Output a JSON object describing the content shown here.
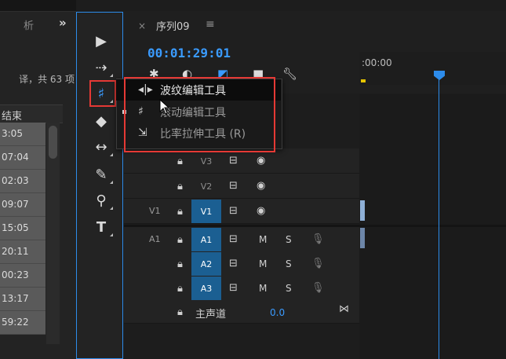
{
  "project_panel": {
    "tab_label": "析",
    "collapse_icon": "double-chevron-right",
    "count_text": "译，共 63 项",
    "column_header": "结束",
    "rows": [
      "3:05",
      "07:04",
      "02:03",
      "09:07",
      "15:05",
      "20:11",
      "00:23",
      "13:17",
      "59:22"
    ]
  },
  "tools": [
    {
      "name": "selection-tool-icon",
      "glyph": "▶"
    },
    {
      "name": "track-select-tool-icon",
      "glyph": "⇢"
    },
    {
      "name": "ripple-edit-tool-icon",
      "glyph": "♯"
    },
    {
      "name": "razor-tool-icon",
      "glyph": "◆"
    },
    {
      "name": "slip-tool-icon",
      "glyph": "↔"
    },
    {
      "name": "pen-tool-icon",
      "glyph": "✎"
    },
    {
      "name": "zoom-tool-icon",
      "glyph": "⚲"
    },
    {
      "name": "type-tool-icon",
      "glyph": "T"
    }
  ],
  "sequence": {
    "close": "×",
    "title": "序列09",
    "menu": "≡",
    "timecode": "00:01:29:01",
    "ruler_label": ":00:00"
  },
  "tracks": [
    {
      "id": "V3",
      "source": "",
      "kind": "video",
      "selected": false
    },
    {
      "id": "V2",
      "source": "",
      "kind": "video",
      "selected": false
    },
    {
      "id": "V1",
      "source": "V1",
      "kind": "video",
      "selected": true
    },
    {
      "id": "A1",
      "source": "A1",
      "kind": "audio",
      "selected": true
    },
    {
      "id": "A2",
      "source": "",
      "kind": "audio",
      "selected": true
    },
    {
      "id": "A3",
      "source": "",
      "kind": "audio",
      "selected": true
    }
  ],
  "master": {
    "label": "主声道",
    "value": "0.0"
  },
  "audio_buttons": {
    "mute": "M",
    "solo": "S"
  },
  "dropdown": {
    "items": [
      {
        "label": "波纹编辑工具",
        "icon": "ripple-edit-icon",
        "glyph": "◂|▸",
        "dim": false,
        "highlight": true
      },
      {
        "label": "滚动编辑工具",
        "icon": "rolling-edit-icon",
        "glyph": "♯",
        "dim": true,
        "highlight": false
      },
      {
        "label": "比率拉伸工具 (R)",
        "icon": "rate-stretch-icon",
        "glyph": "⇲",
        "dim": true,
        "highlight": false
      }
    ]
  },
  "colors": {
    "accent": "#2d8ceb",
    "highlight": "#e53935",
    "track_on": "#1b5f92"
  }
}
